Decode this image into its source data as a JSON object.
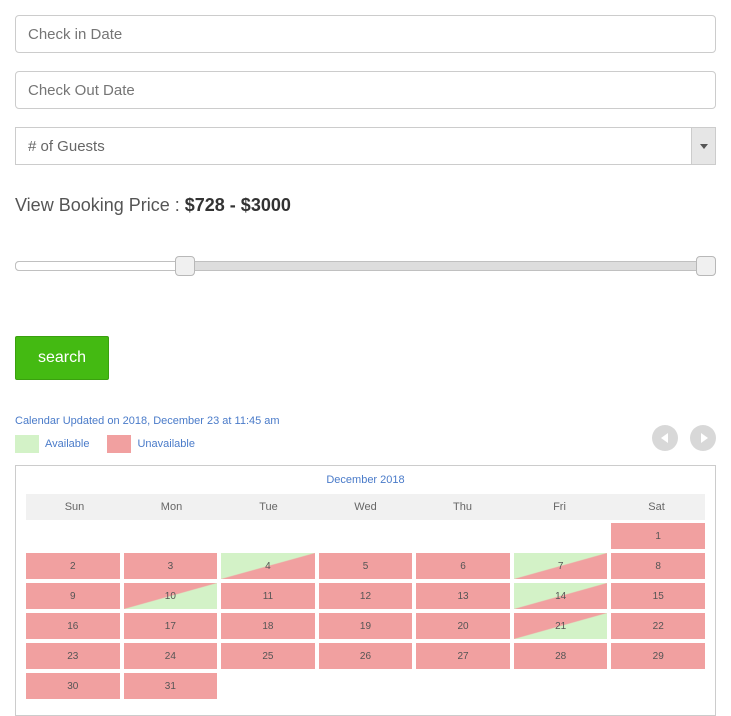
{
  "checkin": {
    "placeholder": "Check in Date"
  },
  "checkout": {
    "placeholder": "Check Out Date"
  },
  "guests": {
    "placeholder": "# of Guests"
  },
  "price": {
    "label": "View Booking Price : ",
    "range": "$728 - $3000"
  },
  "search_label": "search",
  "calendar_updated": "Calendar Updated on 2018, December 23 at 11:45 am",
  "legend": {
    "available": "Available",
    "unavailable": "Unavailable"
  },
  "calendar": {
    "title": "December 2018",
    "weekdays": [
      "Sun",
      "Mon",
      "Tue",
      "Wed",
      "Thu",
      "Fri",
      "Sat"
    ],
    "leading_blanks": 6,
    "days": [
      {
        "n": 1,
        "state": "unavail"
      },
      {
        "n": 2,
        "state": "unavail"
      },
      {
        "n": 3,
        "state": "unavail"
      },
      {
        "n": 4,
        "state": "split"
      },
      {
        "n": 5,
        "state": "unavail"
      },
      {
        "n": 6,
        "state": "unavail"
      },
      {
        "n": 7,
        "state": "split"
      },
      {
        "n": 8,
        "state": "unavail"
      },
      {
        "n": 9,
        "state": "unavail"
      },
      {
        "n": 10,
        "state": "split-rev"
      },
      {
        "n": 11,
        "state": "unavail"
      },
      {
        "n": 12,
        "state": "unavail"
      },
      {
        "n": 13,
        "state": "unavail"
      },
      {
        "n": 14,
        "state": "split"
      },
      {
        "n": 15,
        "state": "unavail"
      },
      {
        "n": 16,
        "state": "unavail"
      },
      {
        "n": 17,
        "state": "unavail"
      },
      {
        "n": 18,
        "state": "unavail"
      },
      {
        "n": 19,
        "state": "unavail"
      },
      {
        "n": 20,
        "state": "unavail"
      },
      {
        "n": 21,
        "state": "split-rev"
      },
      {
        "n": 22,
        "state": "unavail"
      },
      {
        "n": 23,
        "state": "unavail"
      },
      {
        "n": 24,
        "state": "unavail"
      },
      {
        "n": 25,
        "state": "unavail"
      },
      {
        "n": 26,
        "state": "unavail"
      },
      {
        "n": 27,
        "state": "unavail"
      },
      {
        "n": 28,
        "state": "unavail"
      },
      {
        "n": 29,
        "state": "unavail"
      },
      {
        "n": 30,
        "state": "unavail"
      },
      {
        "n": 31,
        "state": "unavail"
      }
    ]
  }
}
